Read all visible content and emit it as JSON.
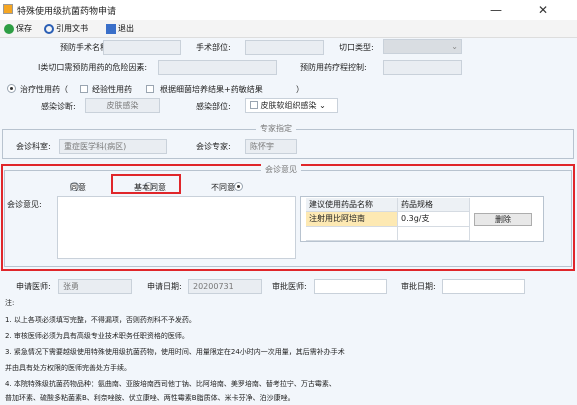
{
  "window": {
    "title": "特殊使用级抗菌药物申请",
    "minimize": "—",
    "close": "✕"
  },
  "toolbar": {
    "save": "保存",
    "cite": "引用文书",
    "exit": "退出"
  },
  "form": {
    "surgery_name_label": "预防手术名称:",
    "surgery_site_label": "手术部位:",
    "incision_type_label": "切口类型:",
    "risk_factor_label": "I类切口需预防用药的危险因素:",
    "course_control_label": "预防用药疗程控制:",
    "treat_label": "治疗性用药（",
    "empirical_label": "经验性用药",
    "culture_label": "根据细菌培养结果+药敏结果",
    "paren_close": "）",
    "diagnosis_label": "感染诊断:",
    "diagnosis_value": "皮肤感染",
    "infection_site_label": "感染部位:",
    "infection_site_value": "皮肤软组织感染",
    "infection_site_arrow": "⌄"
  },
  "consult": {
    "group_title": "专家指定",
    "dept_label": "会诊科室:",
    "dept_value": "重症医学科(病区)",
    "expert_label": "会诊专家:",
    "expert_value": "陈怀宇"
  },
  "opinion": {
    "group_title": "会诊意见",
    "label": "会诊意见:",
    "radio_agree": "同意",
    "radio_basic": "基本同意",
    "radio_disagree": "不同意",
    "grid_headers": [
      "建议使用药品名称",
      "药品规格"
    ],
    "grid_rows": [
      {
        "name": "注射用比阿培南",
        "spec": "0.3g/支",
        "action": "删除"
      }
    ]
  },
  "footer": {
    "applicant_label": "申请医师:",
    "applicant_value": "张勇",
    "apply_date_label": "申请日期:",
    "apply_date_value": "20200731",
    "reviewer_label": "审批医师:",
    "review_date_label": "审批日期:"
  },
  "notes": [
    "注:",
    "1. 以上各项必须填写完整，不得漏项，否则药剂科不予发药。",
    "2. 审核医师必须为具有高级专业技术职务任职资格的医师。",
    "3. 紧急情况下需要越级使用特殊使用级抗菌药物，使用时间、用量限定在24小时内一次用量，其后需补办手术",
    "并由具有处方权限的医师完善处方手续。",
    "4. 本院特殊级抗菌药物品种：氨曲南、亚胺培南西司他丁钠、比阿培南、美罗培南、替考拉宁、万古霉素、",
    "普加环素、硫酸多粘菌素B、利奈唑胺、伏立康唑、两性霉素B脂质体、米卡芬净、泊沙康唑。"
  ],
  "colors": {
    "accent_red": "#e0262a",
    "highlight": "#fde9b3"
  }
}
